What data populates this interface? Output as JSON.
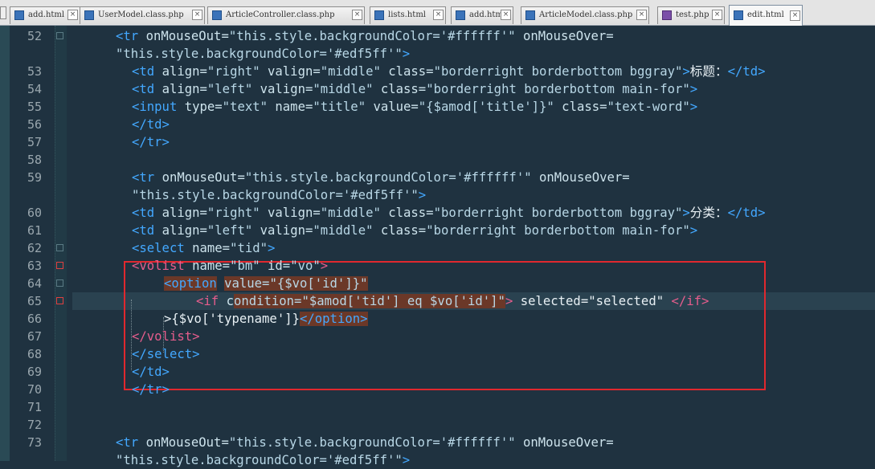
{
  "tabs": [
    {
      "label": "add.html",
      "active": false,
      "icon": "blue-file-icon"
    },
    {
      "label": "UserModel.class.php",
      "active": false,
      "icon": "blue-file-icon"
    },
    {
      "label": "ArticleController.class.php",
      "active": false,
      "icon": "blue-file-icon"
    },
    {
      "label": "lists.html",
      "active": false,
      "icon": "blue-file-icon"
    },
    {
      "label": "add.html",
      "active": false,
      "icon": "blue-file-icon"
    },
    {
      "label": "ArticleModel.class.php",
      "active": false,
      "icon": "blue-file-icon"
    },
    {
      "label": "test.php",
      "active": false,
      "icon": "purple-file-icon"
    },
    {
      "label": "edit.html",
      "active": true,
      "icon": "blue-file-icon"
    }
  ],
  "colors": {
    "background": "#1f3240",
    "tag": "#43a8ff",
    "tag_alt": "#e55d8c",
    "annotation_box": "#e0282e",
    "match_highlight": "#6b3828"
  },
  "lines": [
    {
      "n": "52",
      "segs": [
        {
          "t": "<tr ",
          "c": "tg"
        },
        {
          "t": "onMouseOut=",
          "c": "an"
        },
        {
          "t": "\"this.style.backgroundColor='#ffffff'\"",
          "c": "av"
        },
        {
          "t": " onMouseOver=",
          "c": "an"
        }
      ]
    },
    {
      "n": "",
      "segs": [
        {
          "t": "\"this.style.backgroundColor='#edf5ff'\"",
          "c": "av"
        },
        {
          "t": ">",
          "c": "tg"
        }
      ]
    },
    {
      "n": "53",
      "segs": [
        {
          "t": "<td ",
          "c": "tg"
        },
        {
          "t": "align=",
          "c": "an"
        },
        {
          "t": "\"right\"",
          "c": "av"
        },
        {
          "t": " valign=",
          "c": "an"
        },
        {
          "t": "\"middle\"",
          "c": "av"
        },
        {
          "t": " class=",
          "c": "an"
        },
        {
          "t": "\"borderright borderbottom bggray\"",
          "c": "av"
        },
        {
          "t": ">",
          "c": "tg"
        },
        {
          "t": "标题：",
          "c": "tx"
        },
        {
          "t": "</td>",
          "c": "tg"
        }
      ]
    },
    {
      "n": "54",
      "segs": [
        {
          "t": "<td ",
          "c": "tg"
        },
        {
          "t": "align=",
          "c": "an"
        },
        {
          "t": "\"left\"",
          "c": "av"
        },
        {
          "t": " valign=",
          "c": "an"
        },
        {
          "t": "\"middle\"",
          "c": "av"
        },
        {
          "t": " class=",
          "c": "an"
        },
        {
          "t": "\"borderright borderbottom main-for\"",
          "c": "av"
        },
        {
          "t": ">",
          "c": "tg"
        }
      ]
    },
    {
      "n": "55",
      "segs": [
        {
          "t": "<input ",
          "c": "tg"
        },
        {
          "t": "type=",
          "c": "an"
        },
        {
          "t": "\"text\"",
          "c": "av"
        },
        {
          "t": " name=",
          "c": "an"
        },
        {
          "t": "\"title\"",
          "c": "av"
        },
        {
          "t": " value=",
          "c": "an"
        },
        {
          "t": "\"{$amod['title']}\"",
          "c": "av"
        },
        {
          "t": " class=",
          "c": "an"
        },
        {
          "t": "\"text-word\"",
          "c": "av"
        },
        {
          "t": ">",
          "c": "tg"
        }
      ]
    },
    {
      "n": "56",
      "segs": [
        {
          "t": "</td>",
          "c": "tg"
        }
      ]
    },
    {
      "n": "57",
      "segs": [
        {
          "t": "</tr>",
          "c": "tg"
        }
      ]
    },
    {
      "n": "58",
      "segs": []
    },
    {
      "n": "59",
      "segs": [
        {
          "t": "<tr ",
          "c": "tg"
        },
        {
          "t": "onMouseOut=",
          "c": "an"
        },
        {
          "t": "\"this.style.backgroundColor='#ffffff'\"",
          "c": "av"
        },
        {
          "t": " onMouseOver=",
          "c": "an"
        }
      ]
    },
    {
      "n": "",
      "segs": [
        {
          "t": "\"this.style.backgroundColor='#edf5ff'\"",
          "c": "av"
        },
        {
          "t": ">",
          "c": "tg"
        }
      ]
    },
    {
      "n": "60",
      "segs": [
        {
          "t": "<td ",
          "c": "tg"
        },
        {
          "t": "align=",
          "c": "an"
        },
        {
          "t": "\"right\"",
          "c": "av"
        },
        {
          "t": " valign=",
          "c": "an"
        },
        {
          "t": "\"middle\"",
          "c": "av"
        },
        {
          "t": " class=",
          "c": "an"
        },
        {
          "t": "\"borderright borderbottom bggray\"",
          "c": "av"
        },
        {
          "t": ">",
          "c": "tg"
        },
        {
          "t": "分类：",
          "c": "tx"
        },
        {
          "t": "</td>",
          "c": "tg"
        }
      ]
    },
    {
      "n": "61",
      "segs": [
        {
          "t": "<td ",
          "c": "tg"
        },
        {
          "t": "align=",
          "c": "an"
        },
        {
          "t": "\"left\"",
          "c": "av"
        },
        {
          "t": " valign=",
          "c": "an"
        },
        {
          "t": "\"middle\"",
          "c": "av"
        },
        {
          "t": " class=",
          "c": "an"
        },
        {
          "t": "\"borderright borderbottom main-for\"",
          "c": "av"
        },
        {
          "t": ">",
          "c": "tg"
        }
      ]
    },
    {
      "n": "62",
      "segs": [
        {
          "t": "<select ",
          "c": "tg"
        },
        {
          "t": "name=",
          "c": "an"
        },
        {
          "t": "\"tid\"",
          "c": "av"
        },
        {
          "t": ">",
          "c": "tg"
        }
      ]
    },
    {
      "n": "63",
      "segs": [
        {
          "t": "<volist ",
          "c": "tg pink"
        },
        {
          "t": "name=",
          "c": "an"
        },
        {
          "t": "\"bm\"",
          "c": "av"
        },
        {
          "t": " id=",
          "c": "an"
        },
        {
          "t": "\"vo\"",
          "c": "av"
        },
        {
          "t": ">",
          "c": "tg pink"
        }
      ]
    },
    {
      "n": "64",
      "segs": [
        {
          "t": "<option",
          "c": "tg hlbg"
        },
        {
          "t": " ",
          "c": "an"
        },
        {
          "t": "value=\"{$vo['id']}\"",
          "c": "av hlbg"
        }
      ]
    },
    {
      "n": "65",
      "segs": [
        {
          "t": "<if ",
          "c": "tg pink"
        },
        {
          "t": "c",
          "c": "an"
        },
        {
          "t": "ondition=\"$amod['tid'] eq $vo['id']\"",
          "c": "av hlbg"
        },
        {
          "t": ">",
          "c": "tg pink"
        },
        {
          "t": " selected=\"selected\" ",
          "c": "tx"
        },
        {
          "t": "</if>",
          "c": "tg pink"
        }
      ]
    },
    {
      "n": "66",
      "segs": [
        {
          "t": ">{$vo['typename']}",
          "c": "tx"
        },
        {
          "t": "</option>",
          "c": "tg hlbg"
        }
      ]
    },
    {
      "n": "67",
      "segs": [
        {
          "t": "</volist>",
          "c": "tg pink"
        }
      ]
    },
    {
      "n": "68",
      "segs": [
        {
          "t": "</select>",
          "c": "tg"
        }
      ]
    },
    {
      "n": "69",
      "segs": [
        {
          "t": "</td>",
          "c": "tg"
        }
      ]
    },
    {
      "n": "70",
      "segs": [
        {
          "t": "</tr>",
          "c": "tg"
        }
      ]
    },
    {
      "n": "71",
      "segs": []
    },
    {
      "n": "72",
      "segs": []
    },
    {
      "n": "73",
      "segs": [
        {
          "t": "<tr ",
          "c": "tg"
        },
        {
          "t": "onMouseOut=",
          "c": "an"
        },
        {
          "t": "\"this.style.backgroundColor='#ffffff'\"",
          "c": "av"
        },
        {
          "t": " onMouseOver=",
          "c": "an"
        }
      ]
    },
    {
      "n": "",
      "segs": [
        {
          "t": "\"this.style.backgroundColor='#edf5ff'\"",
          "c": "av"
        },
        {
          "t": ">",
          "c": "tg"
        }
      ]
    }
  ]
}
